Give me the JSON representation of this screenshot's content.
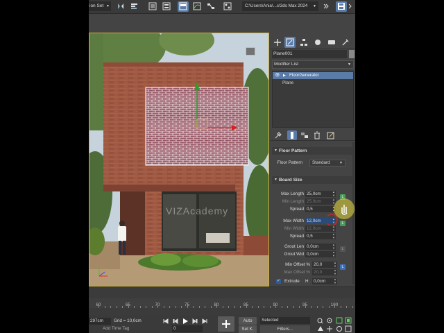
{
  "toolbar": {
    "selection_set": "ion Set",
    "project_path": "C:\\Users\\Ania\\...s\\3ds Max 2024"
  },
  "viewport": {
    "watermark": "VIZAcademy"
  },
  "command_panel": {
    "object_name": "Plane001",
    "modifier_list": "Modifier List",
    "stack": [
      "FloorGenerator",
      "Plane"
    ],
    "floor_pattern": {
      "header": "Floor Pattern",
      "label": "Floor Pattern",
      "value": "Standard"
    },
    "board_size": {
      "header": "Board Size",
      "max_length_label": "Max Length",
      "max_length": "25,0cm",
      "min_length_label": "Min Length",
      "min_length": "25,0cm",
      "spread1_label": "Spread",
      "spread1": "0,5",
      "max_width_label": "Max Width",
      "max_width": "12,0cm",
      "min_width_label": "Min Width",
      "min_width": "12,0cm",
      "spread2_label": "Spread",
      "spread2": "0,5",
      "grout_len_label": "Grout Len",
      "grout_len": "0,0cm",
      "grout_wid_label": "Grout Wid",
      "grout_wid": "0,0cm",
      "min_offset_label": "Min Offset %",
      "min_offset": "20,0",
      "max_offset_label": "Max Offset %",
      "max_offset": "20,0",
      "extrude_label": "Extrude",
      "extrude_h_label": "H",
      "extrude_h": "0,0cm"
    }
  },
  "timeline": {
    "ticks": [
      "60",
      "65",
      "70",
      "75",
      "80",
      "85",
      "90",
      "95",
      "100"
    ]
  },
  "status": {
    "coord": "297cm",
    "grid": "Grid = 10,0cm",
    "add_time_tag": "Add Time Tag",
    "frame": "0",
    "auto": "Auto",
    "set_key": "Set K.",
    "selected": "Selected",
    "filters": "Filters..."
  }
}
